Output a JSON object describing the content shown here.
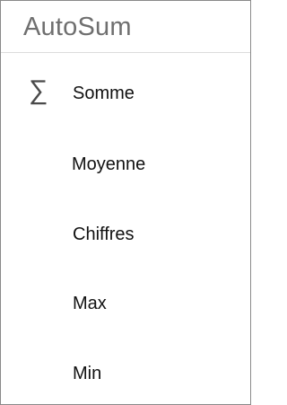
{
  "panel": {
    "title": "AutoSum"
  },
  "menu": {
    "items": [
      {
        "label": "Somme",
        "icon": "sigma-icon",
        "icon_glyph": "∑"
      },
      {
        "label": "Moyenne"
      },
      {
        "label": "Chiffres"
      },
      {
        "label": "Max"
      },
      {
        "label": "Min"
      }
    ]
  }
}
